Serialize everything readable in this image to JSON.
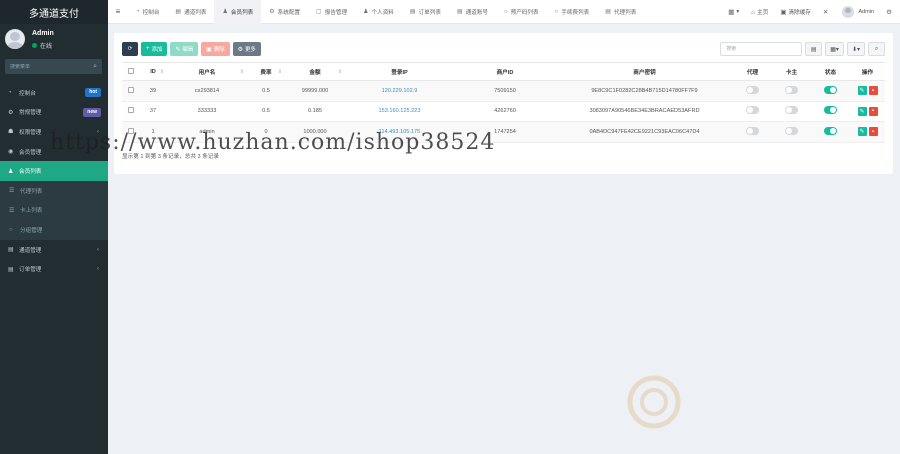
{
  "app": {
    "title": "多通道支付"
  },
  "user": {
    "name": "Admin",
    "status": "在线"
  },
  "sidebar": {
    "search_placeholder": "搜索菜单",
    "items": [
      {
        "icon": "dashboard-icon",
        "label": "控制台",
        "badge": "hot",
        "badge_color": "#1e74c9"
      },
      {
        "icon": "cogs-icon",
        "label": "常规管理",
        "badge": "new",
        "badge_color": "#605ca8"
      },
      {
        "icon": "group-icon",
        "label": "权限管理",
        "caret": "‹"
      },
      {
        "icon": "user-circle-icon",
        "label": "会员管理"
      },
      {
        "icon": "user-icon",
        "label": "会员列表",
        "active": true
      },
      {
        "icon": "list-icon",
        "label": "代理列表"
      },
      {
        "icon": "list-icon",
        "label": "卡上列表"
      },
      {
        "icon": "circle-icon",
        "label": "分组管理"
      },
      {
        "icon": "table-icon",
        "label": "通道管理",
        "caret": "‹"
      },
      {
        "icon": "table-icon",
        "label": "订单管理",
        "caret": "‹"
      }
    ]
  },
  "topnav": {
    "tabs": [
      {
        "icon": "dashboard-icon",
        "label": "控制台"
      },
      {
        "icon": "table-icon",
        "label": "通道列表"
      },
      {
        "icon": "user-icon",
        "label": "会员列表",
        "active": true
      },
      {
        "icon": "cog-icon",
        "label": "系统配置"
      },
      {
        "icon": "file-icon",
        "label": "报告管理"
      },
      {
        "icon": "user-icon",
        "label": "个人资料"
      },
      {
        "icon": "table-icon",
        "label": "订单列表"
      },
      {
        "icon": "table-icon",
        "label": "通道账号"
      },
      {
        "icon": "circle-icon",
        "label": "预产码列表"
      },
      {
        "icon": "circle-icon",
        "label": "手续费列表"
      },
      {
        "icon": "table-icon",
        "label": "代理列表"
      }
    ],
    "right": {
      "home": "主页",
      "clear_cache": "清除缓存",
      "user": "Admin"
    }
  },
  "toolbar": {
    "add": "添加",
    "edit": "编辑",
    "delete": "删除",
    "more": "更多",
    "search_placeholder": "搜索"
  },
  "table": {
    "columns": [
      "",
      "ID",
      "用户名",
      "费率",
      "金额",
      "登录IP",
      "商户ID",
      "商户密钥",
      "代理",
      "卡主",
      "状态",
      "操作"
    ],
    "rows": [
      {
        "id": "39",
        "username": "cs293814",
        "rate": "0.5",
        "amount": "99999.000",
        "ip": "120.229.102.9",
        "merchant_id": "7509150",
        "key": "9E8C9C1F0282C28B4B715D14780FF7F9",
        "agent": false,
        "owner": false,
        "status": true
      },
      {
        "id": "37",
        "username": "333333",
        "rate": "0.5",
        "amount": "0.185",
        "ip": "153.160.125.223",
        "merchant_id": "4262760",
        "key": "3083097A90546BE34E3BRACAED53AFRD",
        "agent": false,
        "owner": false,
        "status": true
      },
      {
        "id": "1",
        "username": "admin",
        "rate": "0",
        "amount": "1000.000",
        "ip": "114.493.105.175",
        "merchant_id": "1747254",
        "key": "0AB4DC947FE42CE9221C93EAC06C47D4",
        "agent": false,
        "owner": false,
        "status": true
      }
    ]
  },
  "footer": {
    "summary": "显示第 1 到第 3 条记录，总共 3 条记录"
  },
  "watermark": {
    "url": "https://www.huzhan.com/ishop38524"
  }
}
